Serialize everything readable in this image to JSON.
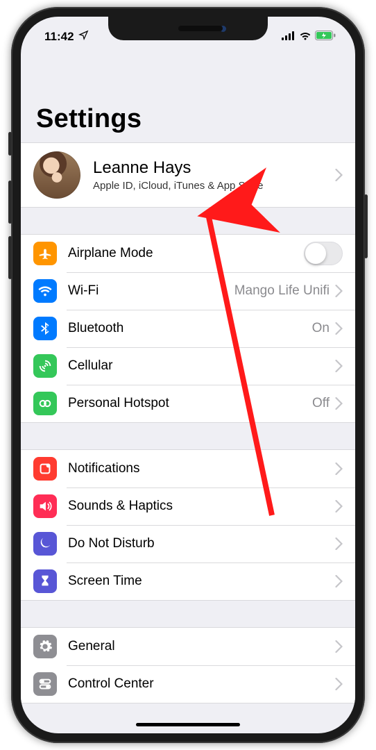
{
  "status": {
    "time": "11:42"
  },
  "title": "Settings",
  "profile": {
    "name": "Leanne Hays",
    "subtitle": "Apple ID, iCloud, iTunes & App Store"
  },
  "group1": {
    "airplane": {
      "label": "Airplane Mode"
    },
    "wifi": {
      "label": "Wi-Fi",
      "detail": "Mango Life Unifi"
    },
    "bluetooth": {
      "label": "Bluetooth",
      "detail": "On"
    },
    "cellular": {
      "label": "Cellular"
    },
    "hotspot": {
      "label": "Personal Hotspot",
      "detail": "Off"
    }
  },
  "group2": {
    "notifications": {
      "label": "Notifications"
    },
    "sounds": {
      "label": "Sounds & Haptics"
    },
    "dnd": {
      "label": "Do Not Disturb"
    },
    "screentime": {
      "label": "Screen Time"
    }
  },
  "group3": {
    "general": {
      "label": "General"
    },
    "controlcenter": {
      "label": "Control Center"
    }
  }
}
